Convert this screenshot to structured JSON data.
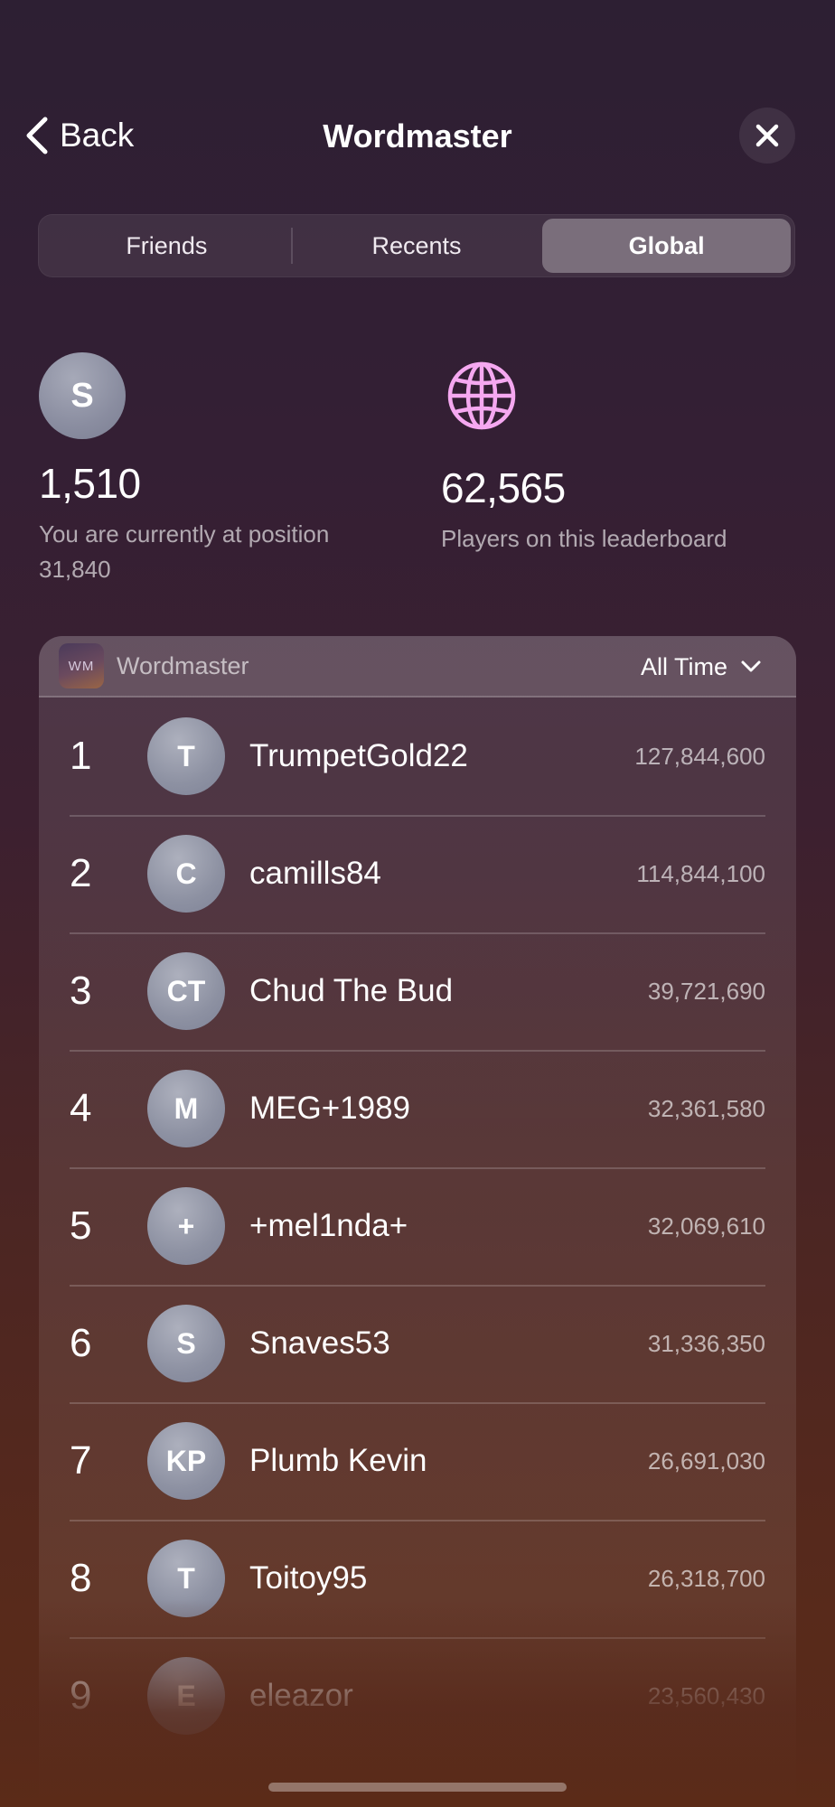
{
  "nav": {
    "back_label": "Back",
    "title": "Wordmaster",
    "close_icon": "close-icon"
  },
  "tabs": [
    {
      "label": "Friends",
      "active": false
    },
    {
      "label": "Recents",
      "active": false
    },
    {
      "label": "Global",
      "active": true
    }
  ],
  "stats": {
    "you": {
      "avatar_initial": "S",
      "value": "1,510",
      "description": "You are currently at position 31,840"
    },
    "players": {
      "icon": "globe-icon",
      "icon_color": "#f5a8f0",
      "value": "62,565",
      "description": "Players on this leaderboard"
    }
  },
  "board": {
    "app_icon_text": "WM",
    "title": "Wordmaster",
    "time_filter": "All Time",
    "rows": [
      {
        "rank": "1",
        "initials": "T",
        "name": "TrumpetGold22",
        "score": "127,844,600"
      },
      {
        "rank": "2",
        "initials": "C",
        "name": "camills84",
        "score": "114,844,100"
      },
      {
        "rank": "3",
        "initials": "CT",
        "name": "Chud The Bud",
        "score": "39,721,690"
      },
      {
        "rank": "4",
        "initials": "M",
        "name": "MEG+1989",
        "score": "32,361,580"
      },
      {
        "rank": "5",
        "initials": "+",
        "name": "+mel1nda+",
        "score": "32,069,610"
      },
      {
        "rank": "6",
        "initials": "S",
        "name": "Snaves53",
        "score": "31,336,350"
      },
      {
        "rank": "7",
        "initials": "KP",
        "name": "Plumb Kevin",
        "score": "26,691,030"
      },
      {
        "rank": "8",
        "initials": "T",
        "name": "Toitoy95",
        "score": "26,318,700"
      },
      {
        "rank": "9",
        "initials": "E",
        "name": "eleazor",
        "score": "23,560,430"
      }
    ]
  }
}
